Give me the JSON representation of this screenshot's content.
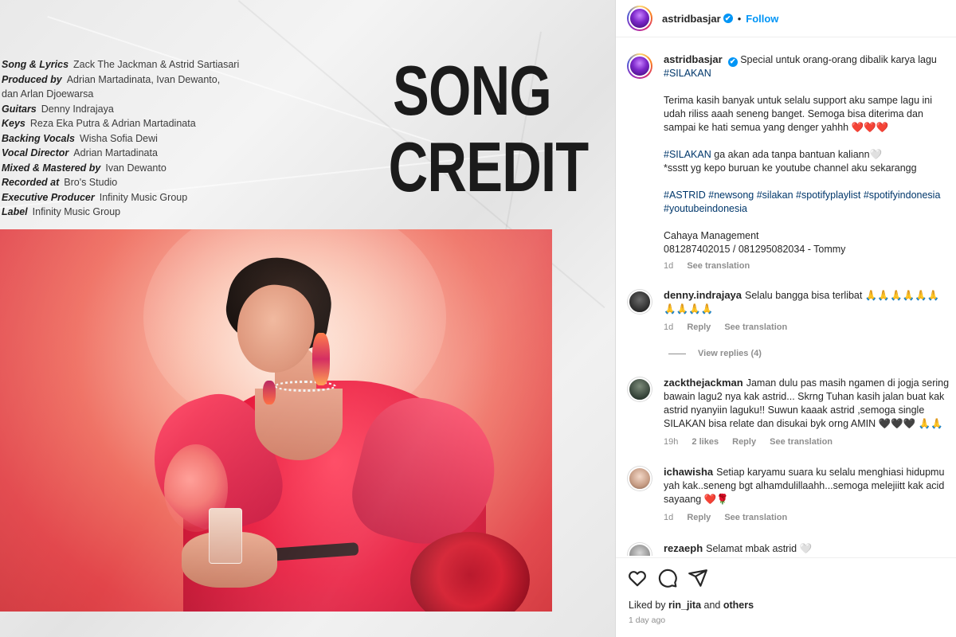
{
  "post_image": {
    "title_line1": "SONG",
    "title_line2": "CREDIT",
    "credits": [
      {
        "role": "Song & Lyrics",
        "name": "Zack The Jackman & Astrid Sartiasari"
      },
      {
        "role": "Produced by",
        "name": "Adrian Martadinata, Ivan Dewanto,",
        "name2": "dan Arlan Djoewarsa"
      },
      {
        "role": "Guitars",
        "name": "Denny Indrajaya"
      },
      {
        "role": "Keys",
        "name": "Reza Eka Putra & Adrian Martadinata"
      },
      {
        "role": "Backing Vocals",
        "name": "Wisha Sofia Dewi"
      },
      {
        "role": "Vocal Director",
        "name": "Adrian Martadinata"
      },
      {
        "role": "Mixed & Mastered by",
        "name": "Ivan Dewanto"
      },
      {
        "role": "Recorded at",
        "name": "Bro's Studio"
      },
      {
        "role": "Executive Producer",
        "name": "Infinity Music Group"
      },
      {
        "role": "Label",
        "name": "Infinity Music Group"
      }
    ]
  },
  "header": {
    "username": "astridbasjar",
    "verified_icon": "✔",
    "separator": "•",
    "follow_label": "Follow"
  },
  "caption": {
    "username": "astridbasjar",
    "verified_icon": "✔",
    "line1": "Special untuk orang-orang dibalik karya lagu",
    "hashtag1": "#SILAKAN",
    "paragraph2": "Terima kasih banyak untuk selalu support aku sampe lagu ini udah riliss aaah seneng banget. Semoga bisa diterima dan sampai ke hati semua yang denger yahhh ❤️❤️❤️",
    "hashtag2": "#SILAKAN",
    "paragraph3_rest": " ga akan ada tanpa bantuan kaliann🤍",
    "paragraph3_line2": "*ssstt yg kepo buruan ke youtube channel aku sekarangg",
    "hashtags": "#ASTRID #newsong #silakan #spotifyplaylist #spotifyindonesia #youtubeindonesia",
    "management": "Cahaya Management",
    "contact": "081287402015 / 081295082034 - Tommy",
    "time": "1d",
    "see_translation": "See translation"
  },
  "comments": [
    {
      "username": "denny.indrajaya",
      "text": "Selalu bangga bisa terlibat 🙏🙏🙏🙏🙏🙏🙏🙏🙏🙏",
      "time": "1d",
      "likes": "",
      "reply": "Reply",
      "see_translation": "See translation",
      "view_replies": "View replies (4)"
    },
    {
      "username": "zackthejackman",
      "text": "Jaman dulu pas masih ngamen di jogja sering bawain lagu2 nya kak astrid... Skrng Tuhan kasih jalan buat kak astrid nyanyiin laguku!! Suwun kaaak astrid ,semoga single SILAKAN bisa relate dan disukai byk orng AMIN 🖤🖤🖤 🙏🙏",
      "time": "19h",
      "likes": "2 likes",
      "reply": "Reply",
      "see_translation": "See translation"
    },
    {
      "username": "ichawisha",
      "text": "Setiap karyamu suara ku selalu menghiasi hidupmu yah kak..seneng bgt alhamdulillaahh...semoga melejiitt kak acid sayaang ❤️🌹",
      "time": "1d",
      "likes": "",
      "reply": "Reply",
      "see_translation": "See translation"
    },
    {
      "username": "rezaeph",
      "text": "Selamat mbak astrid 🤍"
    }
  ],
  "actions": {
    "liked_by_prefix": "Liked by",
    "liked_by_user": "rin_jita",
    "liked_by_and": "and",
    "liked_by_others": "others",
    "post_time": "1 day ago"
  },
  "colors": {
    "link_blue": "#0095f6",
    "hashtag": "#00376b",
    "muted": "#8e8e8e",
    "text": "#262626"
  }
}
